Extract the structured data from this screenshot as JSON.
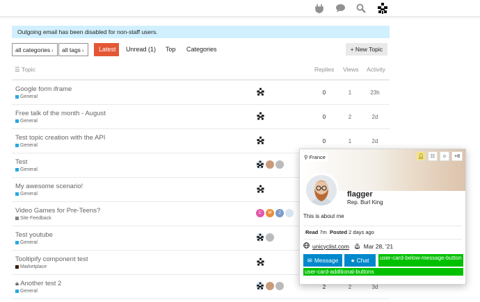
{
  "header": {
    "icons": [
      "plugin-icon",
      "chat-icon",
      "search-icon",
      "user-avatar"
    ]
  },
  "notice": "Outgoing email has been disabled for non-staff users.",
  "nav": {
    "categories_dropdown": "all categories",
    "tags_dropdown": "all tags",
    "tabs": [
      "Latest",
      "Unread (1)",
      "Top",
      "Categories"
    ],
    "new_topic": "+ New Topic"
  },
  "table": {
    "headers": {
      "topic": "Topic",
      "replies": "Replies",
      "views": "Views",
      "activity": "Activity"
    },
    "rows": [
      {
        "title": "Google form iframe",
        "category": "General",
        "cat_color": "#25aae1",
        "replies": "0",
        "views": "1",
        "activity": "23h"
      },
      {
        "title": "Free talk of the month - August",
        "category": "General",
        "cat_color": "#25aae1",
        "replies": "0",
        "views": "2",
        "activity": "2d"
      },
      {
        "title": "Test topic creation with the API",
        "category": "General",
        "cat_color": "#25aae1",
        "replies": "0",
        "views": "1",
        "activity": "2d"
      },
      {
        "title": "Test",
        "category": "General",
        "cat_color": "#25aae1",
        "replies": "",
        "views": "",
        "activity": ""
      },
      {
        "title": "My awesome scenario!",
        "category": "General",
        "cat_color": "#25aae1",
        "replies": "",
        "views": "",
        "activity": ""
      },
      {
        "title": "Video Games for Pre-Teens?",
        "category": "Site Feedback",
        "cat_color": "#808281",
        "replies": "",
        "views": "",
        "activity": ""
      },
      {
        "title": "Test youtube",
        "category": "General",
        "cat_color": "#25aae1",
        "replies": "",
        "views": "",
        "activity": ""
      },
      {
        "title": "Tooltipify component test",
        "category": "Marketplace",
        "cat_color": "#3a1a00",
        "replies": "",
        "views": "",
        "activity": ""
      },
      {
        "title": "Another test 2",
        "category": "General",
        "cat_color": "#25aae1",
        "replies": "2",
        "views": "2",
        "activity": "3d"
      }
    ]
  },
  "user_card": {
    "location": "France",
    "more_badges": "+8",
    "username": "flagger",
    "title": "Rep. Burl King",
    "bio": "This is about me",
    "read_label": "Read",
    "read_value": "7m",
    "posted_label": "Posted",
    "posted_value": "2 days ago",
    "website": "unicyclist.com",
    "birthday": "Mar 28, '21",
    "message_button": "Message",
    "chat_button": "Chat",
    "plugin_outlet_1": "user-card-below-message-button",
    "plugin_outlet_2": "user-card-additional-buttons"
  },
  "colors": {
    "accent": "#e45735",
    "primary_button": "#0088cc",
    "notice_bg": "#d1f0ff",
    "outlet_green": "#00c000"
  }
}
